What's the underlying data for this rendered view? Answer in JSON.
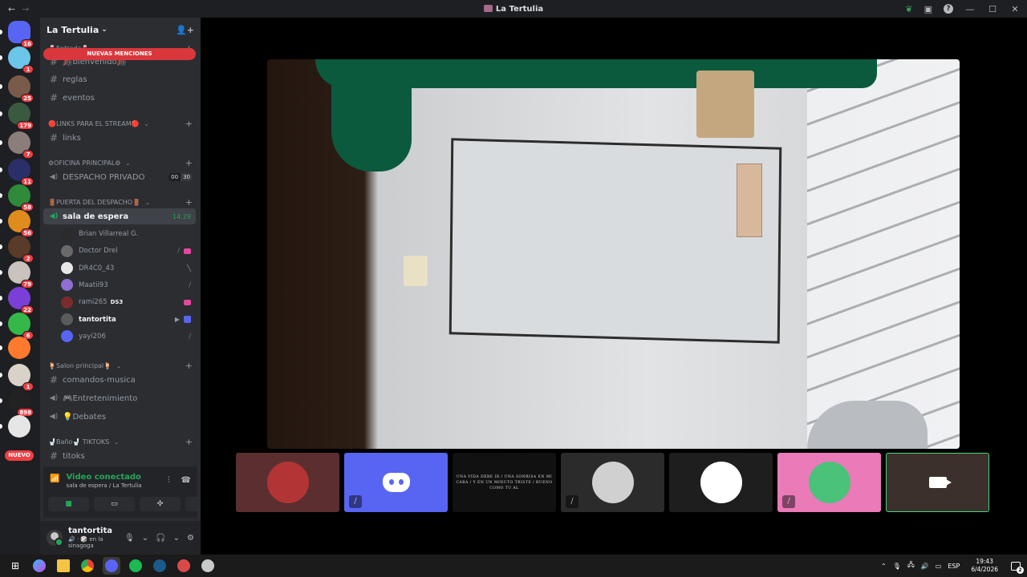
{
  "window": {
    "title": "La Tertulia",
    "back_icon": "arrow-left-icon",
    "forward_icon": "arrow-right-icon",
    "minimize": "—",
    "maximize": "☐",
    "close": "✕"
  },
  "rail": {
    "servers": [
      {
        "name": "direct-messages",
        "badge": "16",
        "color": "#5865f2"
      },
      {
        "name": "server-1",
        "badge": "1",
        "color": "#6cc6e9"
      },
      {
        "name": "server-2",
        "badge": "25",
        "color": "#7a5b4a"
      },
      {
        "name": "server-3",
        "badge": "179",
        "color": "#3a5a3f"
      },
      {
        "name": "server-4",
        "badge": "7",
        "color": "#8b7d7a"
      },
      {
        "name": "server-5",
        "badge": "11",
        "color": "#2a2f6a"
      },
      {
        "name": "server-6",
        "badge": "58",
        "color": "#2f8a3a"
      },
      {
        "name": "server-7",
        "badge": "56",
        "color": "#e08b1d"
      },
      {
        "name": "server-8",
        "badge": "2",
        "color": "#5a3a28"
      },
      {
        "name": "server-9",
        "badge": "79",
        "color": "#c9c2bd"
      },
      {
        "name": "server-10",
        "badge": "22",
        "color": "#7a3fd6"
      },
      {
        "name": "server-11",
        "badge": "6",
        "color": "#35b84a"
      },
      {
        "name": "server-12",
        "badge": "",
        "color": "#ff7a2e"
      },
      {
        "name": "server-13",
        "badge": "1",
        "color": "#d9d2c8"
      },
      {
        "name": "server-14",
        "badge": "898",
        "color": "#222222"
      },
      {
        "name": "server-15",
        "badge": "",
        "color": "#e6e6e6"
      }
    ],
    "new_label": "NUEVO"
  },
  "guild": {
    "name": "La Tertulia",
    "new_mentions": "NUEVAS MENCIONES",
    "categories": [
      {
        "label": "🍷Entrada🍷"
      },
      {
        "label": "🔴LINKS PARA EL STREAM🔴"
      },
      {
        "label": "⚙OFICINA PRINCIPAL⚙"
      },
      {
        "label": "🚪PUERTA DEL DESPACHO🚪"
      },
      {
        "label": "🍹Salon principal🍹"
      },
      {
        "label": "🚽Baño🚽 TIKTOKS"
      }
    ],
    "channels": {
      "bienvenido": "🎊bienvenido🎊",
      "reglas": "reglas",
      "eventos": "eventos",
      "links": "links",
      "despacho": "DESPACHO PRIVADO",
      "despacho_count_a": "00",
      "despacho_count_b": "30",
      "sala": "sala de espera",
      "sala_time": "14:29",
      "comandos": "comandos-musica",
      "entretenimiento": "🎮Entretenimiento",
      "debates": "💡Debates",
      "titoks": "titoks"
    },
    "voice_users": [
      {
        "name": "Brian Villarreal G.",
        "color": "#2b2b2b"
      },
      {
        "name": "Doctor Drel",
        "color": "#6a6a6a"
      },
      {
        "name": "DR4C0_43",
        "color": "#e8e8e8"
      },
      {
        "name": "Maatii93",
        "color": "#8e6fd1"
      },
      {
        "name": "rami265",
        "color": "#7a2b2b",
        "tag": "DS3"
      },
      {
        "name": "tantortita",
        "color": "#5b5b5b"
      },
      {
        "name": "yayi206",
        "color": "#5865f2"
      }
    ]
  },
  "voice_panel": {
    "status": "Video conectado",
    "location": "sala de espera / La Tertulia"
  },
  "user_panel": {
    "username": "tantortita",
    "status": "🔊 · 🎲 en la sinagoga"
  },
  "stream_tiles": [
    {
      "name": "tile-user-red-car",
      "bg": "#5b2f2f",
      "avatar": "#b23434",
      "muted": false
    },
    {
      "name": "tile-discord-default",
      "bg": "#5865f2",
      "avatar": "",
      "muted": true
    },
    {
      "name": "tile-quote",
      "bg": "#111111",
      "avatar": "",
      "muted": false
    },
    {
      "name": "tile-user-bw",
      "bg": "#2b2b2b",
      "avatar": "#d0d0d0",
      "muted": true
    },
    {
      "name": "tile-user-white",
      "bg": "#1e1e1e",
      "avatar": "#ffffff",
      "muted": false
    },
    {
      "name": "tile-user-pink",
      "bg": "#ea7ab8",
      "avatar": "#4bc27a",
      "muted": true
    },
    {
      "name": "tile-self-camera",
      "bg": "#3b302b",
      "avatar": "",
      "muted": false
    }
  ],
  "quote_text": "UNA VIDA DEBE IR / UNA SONRISA EN MI CARA / Y EN UN MINUTO TRISTE / BUENO COMO TU AL",
  "taskbar": {
    "apps": [
      "start-icon",
      "copilot-icon",
      "file-explorer-icon",
      "chrome-icon",
      "discord-icon",
      "spotify-icon",
      "steam-icon",
      "app-icon",
      "app2-icon"
    ],
    "lang": "ESP",
    "time": "19:43",
    "date": "6/4/2026",
    "notifications": "2"
  }
}
